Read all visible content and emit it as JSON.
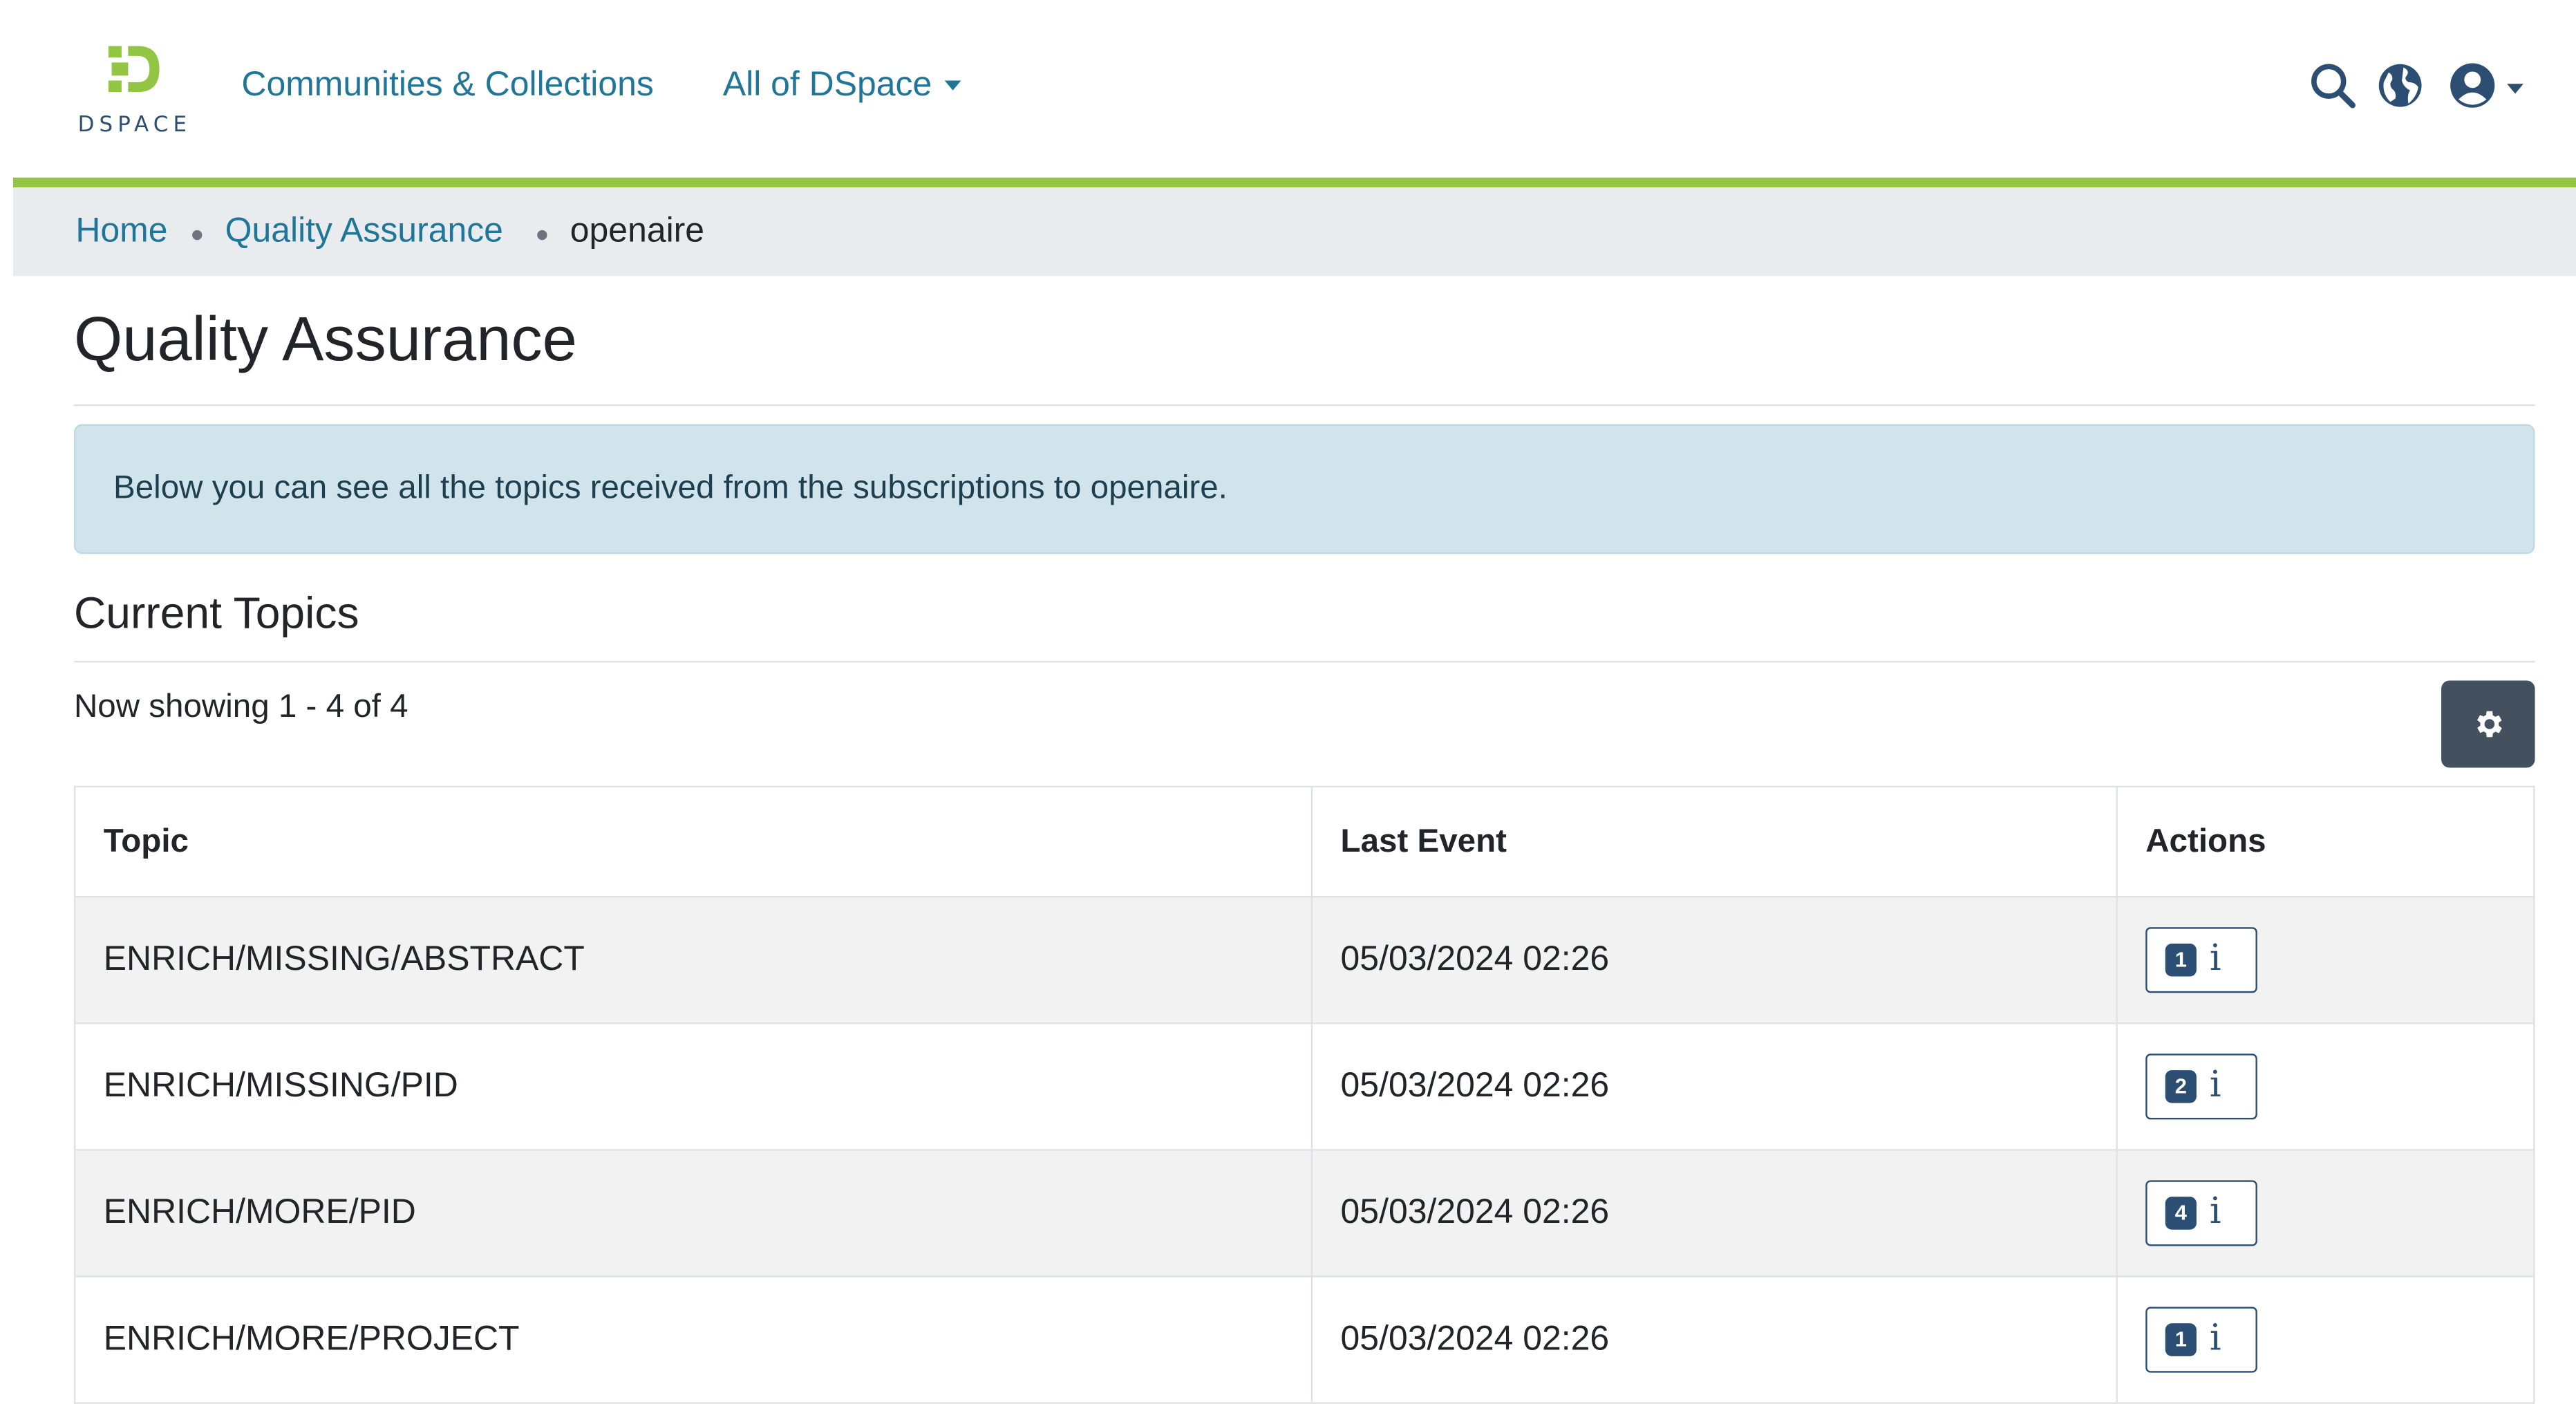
{
  "header": {
    "logo_text": "DSPACE",
    "nav": [
      {
        "label": "Communities & Collections"
      },
      {
        "label": "All of DSpace"
      }
    ],
    "icons": [
      "search-icon",
      "language-globe-icon",
      "user-menu-icon"
    ]
  },
  "breadcrumb": [
    "Home",
    "Quality Assurance",
    "openaire"
  ],
  "page_title": "Quality Assurance",
  "alert_text": "Below you can see all the topics received from the subscriptions to openaire.",
  "section_title": "Current Topics",
  "showing_text": "Now showing 1 - 4 of 4",
  "settings_icon": "gear-icon",
  "table": {
    "columns": [
      "Topic",
      "Last Event",
      "Actions"
    ],
    "rows": [
      {
        "topic": "ENRICH/MISSING/ABSTRACT",
        "last_event": "05/03/2024 02:26",
        "count": "1"
      },
      {
        "topic": "ENRICH/MISSING/PID",
        "last_event": "05/03/2024 02:26",
        "count": "2"
      },
      {
        "topic": "ENRICH/MORE/PID",
        "last_event": "05/03/2024 02:26",
        "count": "4"
      },
      {
        "topic": "ENRICH/MORE/PROJECT",
        "last_event": "05/03/2024 02:26",
        "count": "1"
      }
    ],
    "info_symbol": "i"
  },
  "colors": {
    "link": "#207698",
    "brand_dark": "#2b4e72",
    "brand_green": "#92c642",
    "alert_bg": "#d1e4ec",
    "settings_button": "#43515f"
  }
}
